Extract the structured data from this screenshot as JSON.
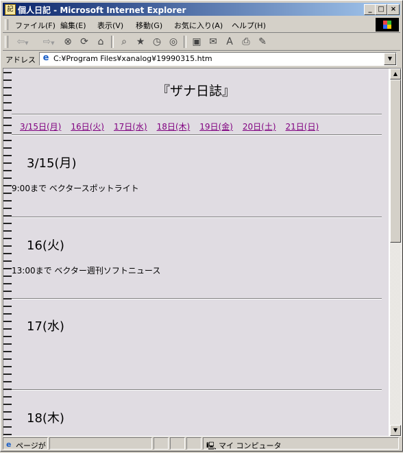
{
  "window": {
    "title": "個人日記 - Microsoft Internet Explorer",
    "minimize": "_",
    "maximize": "□",
    "close": "×"
  },
  "menu": [
    "ファイル(F)",
    "編集(E)",
    "表示(V)",
    "移動(G)",
    "お気に入り(A)",
    "ヘルプ(H)"
  ],
  "toolbar_icons": [
    "back-icon",
    "forward-icon",
    "stop-icon",
    "refresh-icon",
    "home-icon",
    "search-icon",
    "favorites-icon",
    "history-icon",
    "channels-icon",
    "fullscreen-icon",
    "mail-icon",
    "font-icon",
    "print-icon",
    "edit-icon"
  ],
  "address": {
    "label": "アドレス",
    "url": "C:¥Program Files¥xanalog¥19990315.htm"
  },
  "page": {
    "title": "『ザナ日誌』",
    "nav_links": [
      "3/15日(月)",
      "16日(火)",
      "17日(水)",
      "18日(木)",
      "19日(金)",
      "20日(土)",
      "21日(日)"
    ],
    "days": [
      {
        "heading": "3/15(月)",
        "entry": "9:00まで ベクタースポットライト"
      },
      {
        "heading": "16(火)",
        "entry": "13:00まで ベクター週刊ソフトニュース"
      },
      {
        "heading": "17(水)",
        "entry": ""
      },
      {
        "heading": "18(木)",
        "entry": ""
      }
    ]
  },
  "status": {
    "text": "ページが",
    "zone": "マイ コンピュータ"
  }
}
